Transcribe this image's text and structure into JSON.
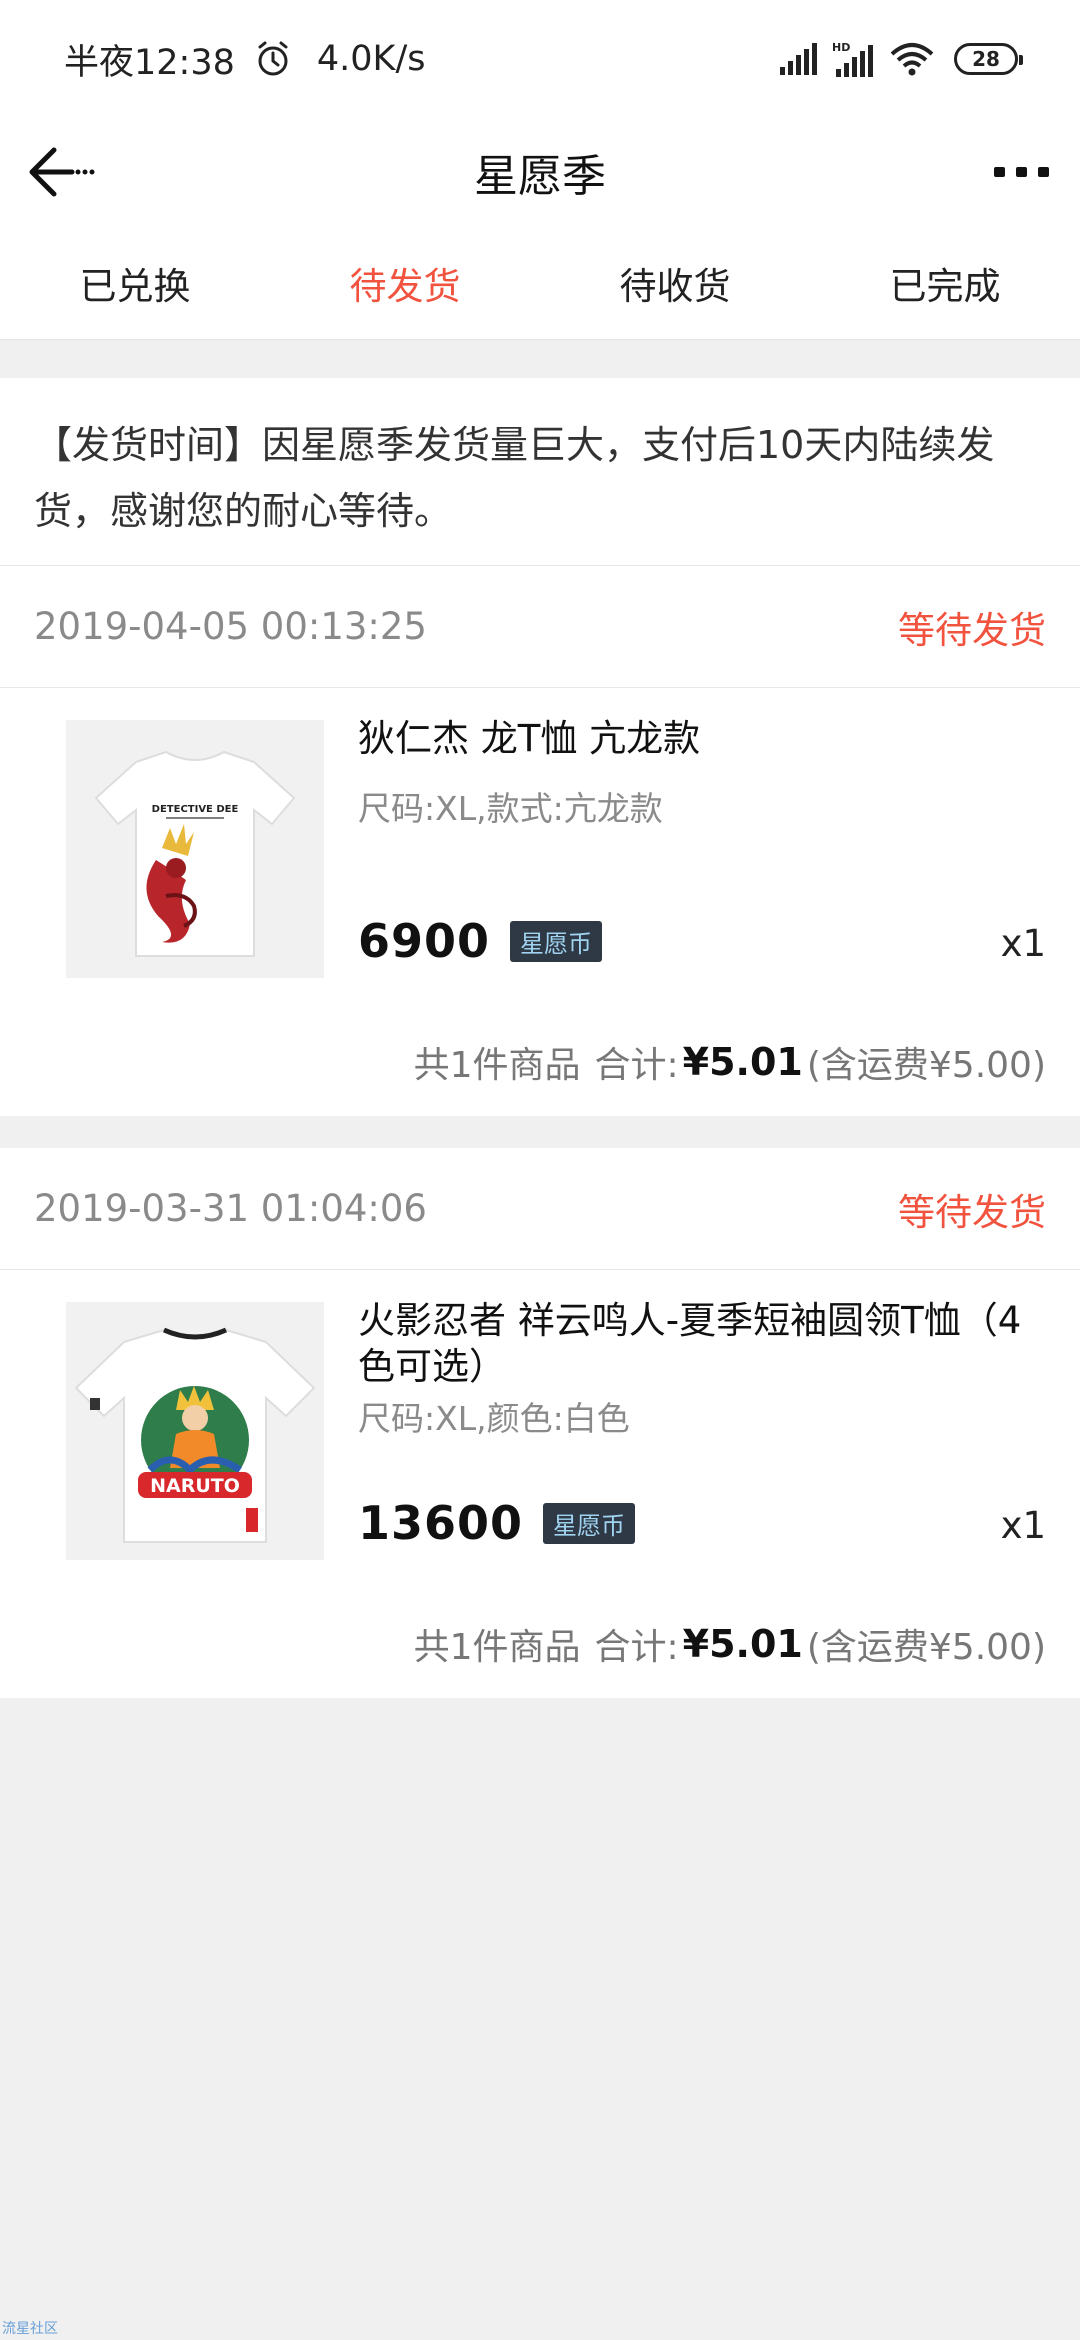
{
  "status_bar": {
    "time": "半夜12:38",
    "net_speed": "4.0K/s",
    "battery": "28"
  },
  "header": {
    "title": "星愿季"
  },
  "tabs": [
    {
      "label": "已兑换",
      "active": false
    },
    {
      "label": "待发货",
      "active": true
    },
    {
      "label": "待收货",
      "active": false
    },
    {
      "label": "已完成",
      "active": false
    }
  ],
  "notice": "【发货时间】因星愿季发货量巨大，支付后10天内陆续发货，感谢您的耐心等待。",
  "orders": [
    {
      "date": "2019-04-05 00:13:25",
      "status": "等待发货",
      "item": {
        "name": "狄仁杰 龙T恤 亢龙款",
        "spec": "尺码:XL,款式:亢龙款",
        "price": "6900",
        "currency_tag": "星愿币",
        "qty": "x1",
        "image_text": "DETECTIVE DEE"
      },
      "summary": {
        "count": "共1件商品",
        "total_label": "合计:",
        "total": "¥5.01",
        "shipping": "(含运费¥5.00)"
      }
    },
    {
      "date": "2019-03-31 01:04:06",
      "status": "等待发货",
      "item": {
        "name": "火影忍者 祥云鸣人-夏季短袖圆领T恤（4色可选）",
        "spec": "尺码:XL,颜色:白色",
        "price": "13600",
        "currency_tag": "星愿币",
        "qty": "x1",
        "image_text": "NARUTO"
      },
      "summary": {
        "count": "共1件商品",
        "total_label": "合计:",
        "total": "¥5.01",
        "shipping": "(含运费¥5.00)"
      }
    }
  ],
  "watermark": "流星社区",
  "colors": {
    "accent": "#f2533f",
    "background": "#f0f0f0",
    "coin_tag_bg": "#2f3845",
    "coin_tag_text": "#9fd3f0"
  }
}
